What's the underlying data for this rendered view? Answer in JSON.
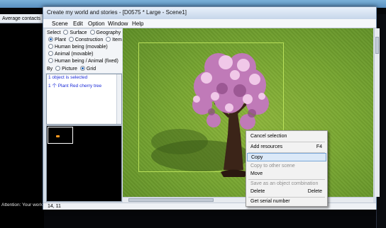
{
  "background_app": {
    "panel_header": "Average contacts",
    "status_text": "Attention: Your worki"
  },
  "window": {
    "title": "Create my world and stories - [D0575 * Large - Scene1]"
  },
  "menubar": {
    "items": [
      "Scene",
      "Edit",
      "Option",
      "Window",
      "Help"
    ]
  },
  "options": {
    "select_label": "Select",
    "select_options": [
      "Surface",
      "Geography"
    ],
    "type_options": [
      "Plant",
      "Construction",
      "Item",
      "Human being (movable)",
      "Animal (movable)",
      "Human being / Animal (fixed)"
    ],
    "selected_type": "Plant",
    "by_label": "By",
    "by_options": [
      "Picture",
      "Grid"
    ],
    "selected_by": "Grid"
  },
  "selection_info": {
    "line1": "1 object is selected",
    "line2": "1 个 Plant Red cherry tree"
  },
  "status": {
    "coords": "14, 11"
  },
  "context_menu": {
    "items": [
      {
        "label": "Cancel selection",
        "key": "",
        "enabled": true,
        "highlighted": false
      },
      {
        "label": "Add resources",
        "key": "F4",
        "enabled": true,
        "highlighted": false
      },
      {
        "label": "Copy",
        "key": "",
        "enabled": true,
        "highlighted": true
      },
      {
        "label": "Copy to other scene",
        "key": "",
        "enabled": false,
        "highlighted": false
      },
      {
        "label": "Move",
        "key": "",
        "enabled": true,
        "highlighted": false
      },
      {
        "label": "Save as an object combination",
        "key": "",
        "enabled": false,
        "highlighted": false
      },
      {
        "label": "Delete",
        "key": "Delete",
        "enabled": true,
        "highlighted": false
      },
      {
        "label": "Get serial number",
        "key": "",
        "enabled": true,
        "highlighted": false
      }
    ]
  },
  "colors": {
    "grass": "#7aa832",
    "accent": "#1a5fb4",
    "highlight": "#dbe9f8"
  }
}
